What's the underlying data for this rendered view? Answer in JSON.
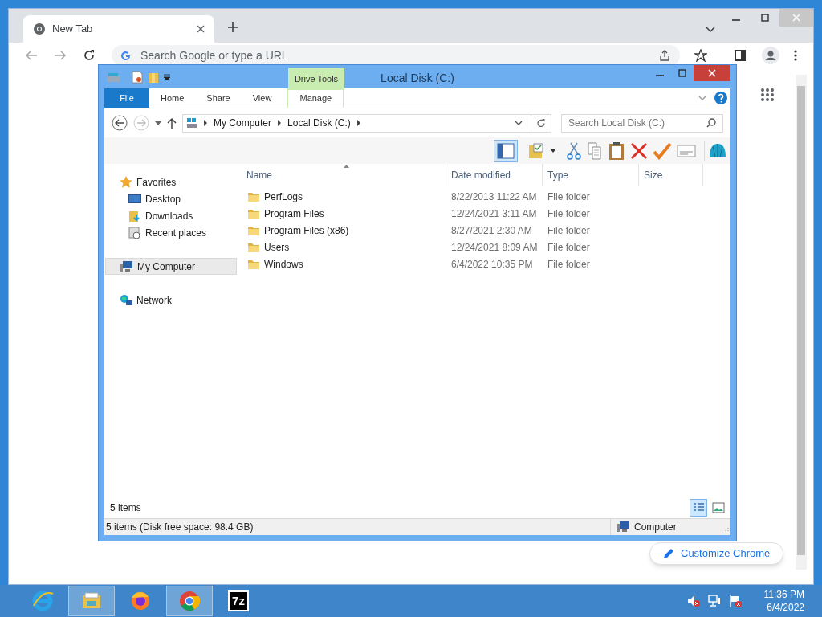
{
  "browser": {
    "tabs": [
      {
        "title": "New Tab",
        "selected": true
      }
    ],
    "omnibox": {
      "placeholder": "Search Google or type a URL"
    },
    "customize_button": "Customize Chrome"
  },
  "explorer": {
    "title": "Local Disk (C:)",
    "ribbon": {
      "context_group": "Drive Tools",
      "tabs": [
        {
          "label": "File",
          "kind": "file",
          "selected": false
        },
        {
          "label": "Home",
          "kind": "tab",
          "selected": false
        },
        {
          "label": "Share",
          "kind": "tab",
          "selected": false
        },
        {
          "label": "View",
          "kind": "tab",
          "selected": false
        },
        {
          "label": "Manage",
          "kind": "context",
          "selected": false
        }
      ]
    },
    "breadcrumb": [
      "My Computer",
      "Local Disk (C:)"
    ],
    "search": {
      "placeholder": "Search Local Disk (C:)"
    },
    "navigation": [
      {
        "label": "Favorites",
        "kind": "star",
        "selected": false,
        "children": [
          {
            "label": "Desktop",
            "kind": "desktop",
            "selected": false
          },
          {
            "label": "Downloads",
            "kind": "downloads",
            "selected": false
          },
          {
            "label": "Recent places",
            "kind": "recent",
            "selected": false
          }
        ]
      },
      {
        "label": "My Computer",
        "kind": "computer",
        "selected": true
      },
      {
        "label": "Network",
        "kind": "network",
        "selected": false
      }
    ],
    "columns": [
      "Name",
      "Date modified",
      "Type",
      "Size"
    ],
    "rows": [
      {
        "name": "PerfLogs",
        "date": "8/22/2013 11:22 AM",
        "type": "File folder"
      },
      {
        "name": "Program Files",
        "date": "12/24/2021 3:11 AM",
        "type": "File folder"
      },
      {
        "name": "Program Files (x86)",
        "date": "8/27/2021 2:30 AM",
        "type": "File folder"
      },
      {
        "name": "Users",
        "date": "12/24/2021 8:09 AM",
        "type": "File folder"
      },
      {
        "name": "Windows",
        "date": "6/4/2022 10:35 PM",
        "type": "File folder"
      }
    ],
    "item_count": "5 items",
    "views": [
      {
        "kind": "details",
        "selected": true
      },
      {
        "kind": "thumbnails",
        "selected": false
      }
    ],
    "status_bar": {
      "text": "5 items (Disk free space: 98.4 GB)",
      "location": "Computer"
    }
  },
  "taskbar": {
    "apps": [
      {
        "kind": "ie",
        "selected": false
      },
      {
        "kind": "explorer",
        "selected": true
      },
      {
        "kind": "firefox",
        "selected": false
      },
      {
        "kind": "chrome",
        "selected": true
      },
      {
        "kind": "sevenzip",
        "label": "7z",
        "selected": false
      }
    ],
    "time": "11:36 PM",
    "date": "6/4/2022"
  }
}
